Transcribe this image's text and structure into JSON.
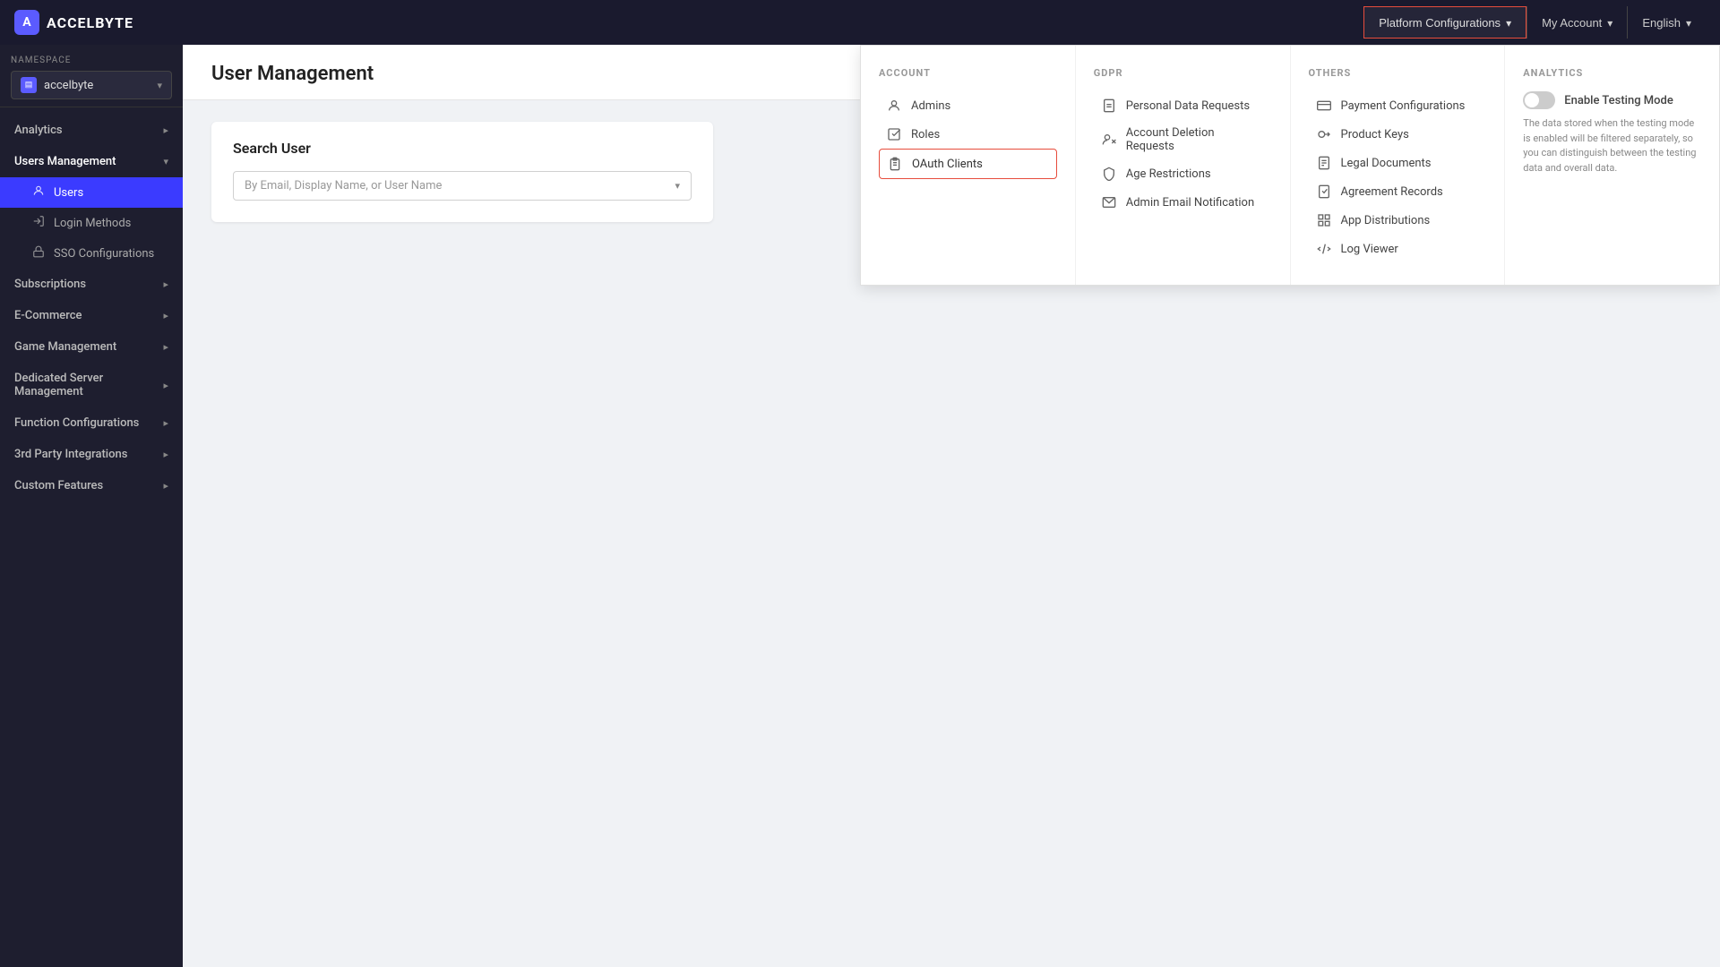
{
  "header": {
    "logo_icon": "A",
    "logo_text": "ACCELBYTE",
    "platform_config_label": "Platform Configurations",
    "my_account_label": "My Account",
    "language_label": "English"
  },
  "sidebar": {
    "namespace_label": "NAMESPACE",
    "namespace_value": "accelbyte",
    "namespace_icon": "▤",
    "items": [
      {
        "id": "analytics",
        "label": "Analytics",
        "has_children": true,
        "expanded": false
      },
      {
        "id": "users-management",
        "label": "Users Management",
        "has_children": true,
        "expanded": true
      },
      {
        "id": "subscriptions",
        "label": "Subscriptions",
        "has_children": true,
        "expanded": false
      },
      {
        "id": "ecommerce",
        "label": "E-Commerce",
        "has_children": true,
        "expanded": false
      },
      {
        "id": "game-management",
        "label": "Game Management",
        "has_children": true,
        "expanded": false
      },
      {
        "id": "dedicated-server",
        "label": "Dedicated Server Management",
        "has_children": true,
        "expanded": false
      },
      {
        "id": "function-configs",
        "label": "Function Configurations",
        "has_children": true,
        "expanded": false
      },
      {
        "id": "3rd-party",
        "label": "3rd Party Integrations",
        "has_children": true,
        "expanded": false
      },
      {
        "id": "custom-features",
        "label": "Custom Features",
        "has_children": true,
        "expanded": false
      }
    ],
    "users_sub_items": [
      {
        "id": "users",
        "label": "Users",
        "icon": "👤",
        "active": true
      },
      {
        "id": "login-methods",
        "label": "Login Methods",
        "icon": "→",
        "active": false
      },
      {
        "id": "sso-configurations",
        "label": "SSO Configurations",
        "icon": "🔒",
        "active": false
      }
    ]
  },
  "main": {
    "page_title": "User Management",
    "search_card_title": "Search User",
    "search_placeholder": "By Email, Display Name, or User Name"
  },
  "platform_dropdown": {
    "sections": {
      "account": {
        "title": "ACCOUNT",
        "items": [
          {
            "id": "admins",
            "label": "Admins",
            "icon": "person"
          },
          {
            "id": "roles",
            "label": "Roles",
            "icon": "check-square"
          },
          {
            "id": "oauth-clients",
            "label": "OAuth Clients",
            "icon": "clipboard",
            "highlighted": true
          }
        ]
      },
      "gdpr": {
        "title": "GDPR",
        "items": [
          {
            "id": "personal-data",
            "label": "Personal Data Requests",
            "icon": "file"
          },
          {
            "id": "account-deletion",
            "label": "Account Deletion Requests",
            "icon": "person-x"
          },
          {
            "id": "age-restrictions",
            "label": "Age Restrictions",
            "icon": "shield"
          },
          {
            "id": "admin-email",
            "label": "Admin Email Notification",
            "icon": "mail"
          }
        ]
      },
      "others": {
        "title": "OTHERS",
        "items": [
          {
            "id": "payment-configs",
            "label": "Payment Configurations",
            "icon": "credit-card"
          },
          {
            "id": "product-keys",
            "label": "Product Keys",
            "icon": "key"
          },
          {
            "id": "legal-documents",
            "label": "Legal Documents",
            "icon": "document"
          },
          {
            "id": "agreement-records",
            "label": "Agreement Records",
            "icon": "check-doc"
          },
          {
            "id": "app-distributions",
            "label": "App Distributions",
            "icon": "grid"
          },
          {
            "id": "log-viewer",
            "label": "Log Viewer",
            "icon": "code"
          }
        ]
      },
      "analytics": {
        "title": "ANALYTICS",
        "toggle_label": "Enable Testing Mode",
        "toggle_desc": "The data stored when the testing mode is enabled will be filtered separately, so you can distinguish between the testing data and overall data."
      }
    }
  }
}
